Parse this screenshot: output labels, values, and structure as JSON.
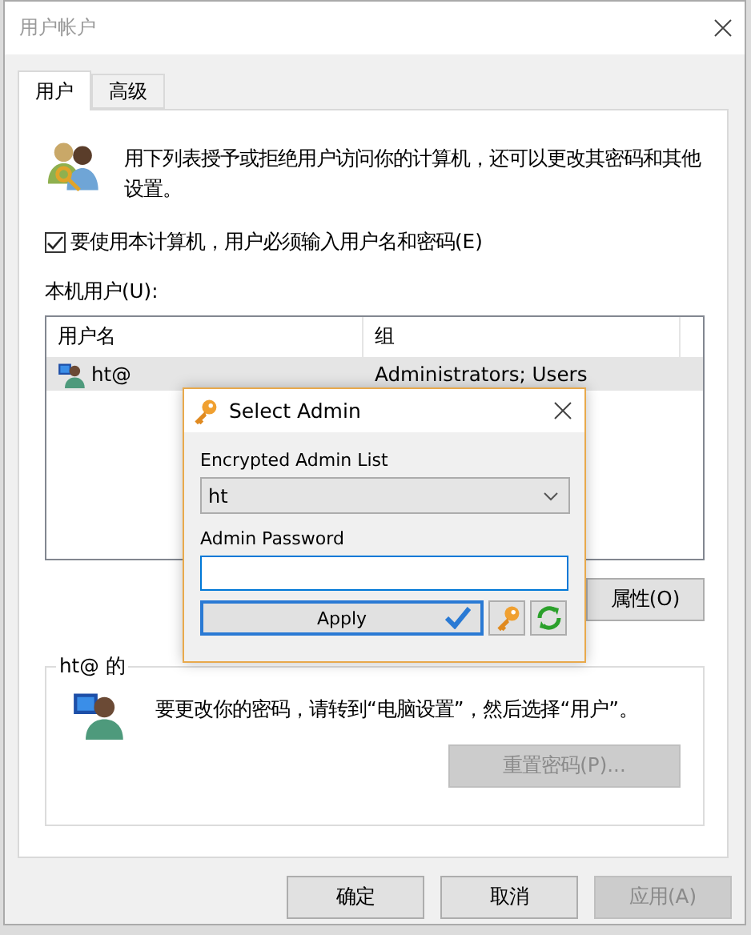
{
  "window": {
    "title": "用户帐户"
  },
  "tabs": [
    {
      "label": "用户",
      "selected": true
    },
    {
      "label": "高级",
      "selected": false
    }
  ],
  "intro": "用下列表授予或拒绝用户访问你的计算机，还可以更改其密码和其他设置。",
  "require_login": {
    "label": "要使用本计算机，用户必须输入用户名和密码(E)",
    "checked": true
  },
  "users_label": "本机用户(U):",
  "table": {
    "columns": [
      "用户名",
      "组"
    ],
    "rows": [
      {
        "name": "ht@",
        "group": "Administrators; Users",
        "selected": true
      }
    ]
  },
  "properties_button": {
    "label": "属性(O)",
    "disabled": false
  },
  "password_group": {
    "legend": "ht@ 的",
    "text": "要更改你的密码，请转到“电脑设置”，然后选择“用户”。",
    "reset_button": {
      "label": "重置密码(P)...",
      "disabled": true
    }
  },
  "footer_buttons": [
    {
      "label": "确定",
      "disabled": false
    },
    {
      "label": "取消",
      "disabled": false
    },
    {
      "label": "应用(A)",
      "disabled": true
    }
  ],
  "dialog": {
    "title": "Select Admin",
    "list_label": "Encrypted Admin List",
    "list_value": "ht",
    "password_label": "Admin Password",
    "apply": "Apply"
  }
}
